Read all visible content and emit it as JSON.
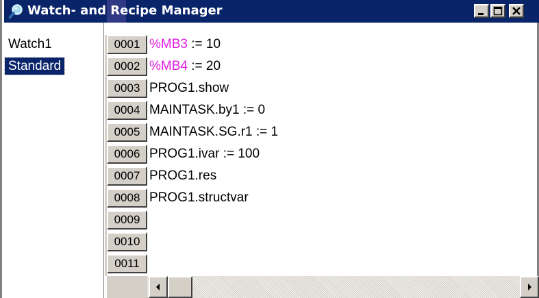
{
  "window": {
    "title": "Watch- and Recipe Manager"
  },
  "icons": {
    "app": "magnifier-icon",
    "minimize": "minimize-icon",
    "maximize": "maximize-icon",
    "close": "close-icon",
    "scroll_left": "arrow-left-icon",
    "scroll_right": "arrow-right-icon"
  },
  "colors": {
    "titlebar": "#0a246a",
    "address_highlight": "#e020e0",
    "selection": "#0a246a"
  },
  "watch_lists": [
    {
      "label": "Watch1",
      "selected": false
    },
    {
      "label": "Standard",
      "selected": true
    }
  ],
  "lines": [
    {
      "num": "0001",
      "addr": "%MB3",
      "rest": " := 10"
    },
    {
      "num": "0002",
      "addr": "%MB4",
      "rest": " := 20"
    },
    {
      "num": "0003",
      "addr": "",
      "rest": "PROG1.show"
    },
    {
      "num": "0004",
      "addr": "",
      "rest": "MAINTASK.by1 := 0"
    },
    {
      "num": "0005",
      "addr": "",
      "rest": "MAINTASK.SG.r1 := 1"
    },
    {
      "num": "0006",
      "addr": "",
      "rest": "PROG1.ivar := 100"
    },
    {
      "num": "0007",
      "addr": "",
      "rest": "PROG1.res"
    },
    {
      "num": "0008",
      "addr": "",
      "rest": "PROG1.structvar"
    },
    {
      "num": "0009",
      "addr": "",
      "rest": ""
    },
    {
      "num": "0010",
      "addr": "",
      "rest": ""
    },
    {
      "num": "0011",
      "addr": "",
      "rest": ""
    }
  ]
}
